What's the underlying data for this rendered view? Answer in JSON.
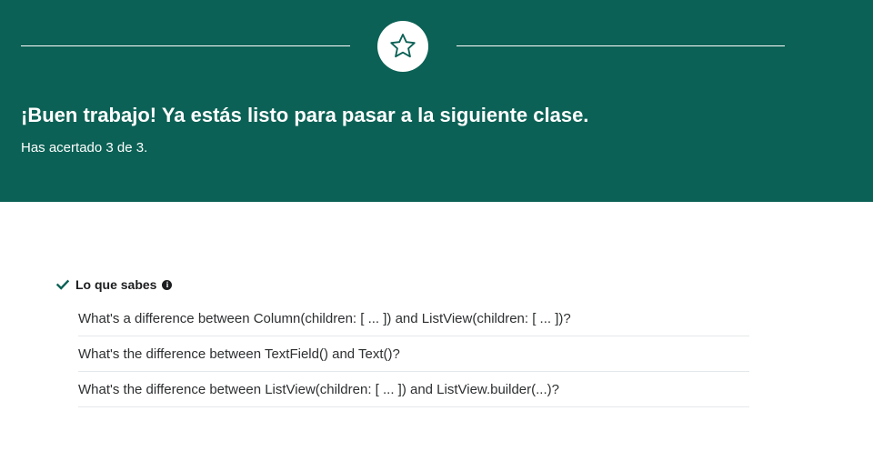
{
  "banner": {
    "background_color": "#0b6155",
    "icon": "star-icon",
    "headline": "¡Buen trabajo! Ya estás listo para pasar a la siguiente clase.",
    "score_text": "Has acertado 3 de 3."
  },
  "known": {
    "icon": "check-icon",
    "title": "Lo que sabes",
    "info_icon": "info-icon",
    "questions": [
      "What's a difference between Column(children: [ ... ]) and ListView(children: [ ... ])?",
      "What's the difference between TextField() and Text()?",
      "What's the difference between ListView(children: [ ... ]) and ListView.builder(...)?"
    ]
  }
}
